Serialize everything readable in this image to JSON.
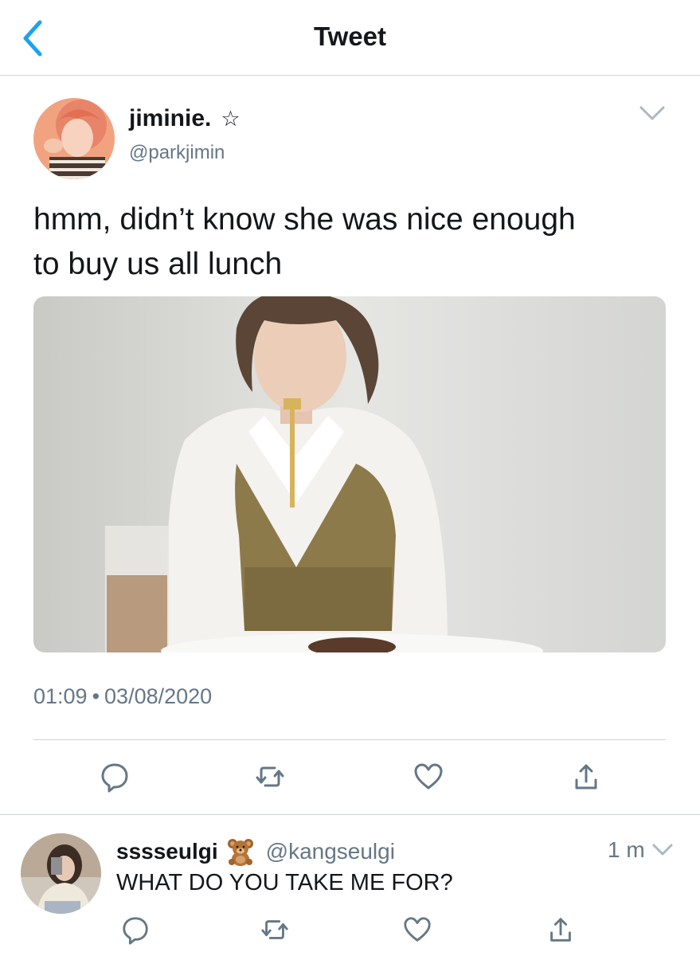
{
  "header": {
    "title": "Tweet",
    "back_icon": "chevron-left-icon",
    "accent_color": "#1da1f2"
  },
  "tweet": {
    "display_name": "jiminie.",
    "name_icon": "star-outline-icon",
    "handle": "@parkjimin",
    "text_line1": "hmm, didn’t know she was nice enough",
    "text_line2": "to buy us all lunch",
    "time": "01:09",
    "separator": "•",
    "date": "03/08/2020",
    "actions": [
      "reply-icon",
      "retweet-icon",
      "like-icon",
      "share-icon"
    ]
  },
  "reply": {
    "display_name": "sssseulgi",
    "name_emoji": "teddy-bear-icon",
    "handle": "@kangseulgi",
    "time": "1 m",
    "text": "WHAT DO YOU TAKE ME FOR?",
    "actions": [
      "reply-icon",
      "retweet-icon",
      "like-icon",
      "share-icon"
    ]
  },
  "colors": {
    "text_primary": "#14171a",
    "text_secondary": "#657786",
    "divider": "#cfd4d8",
    "icon_gray": "#657786"
  }
}
